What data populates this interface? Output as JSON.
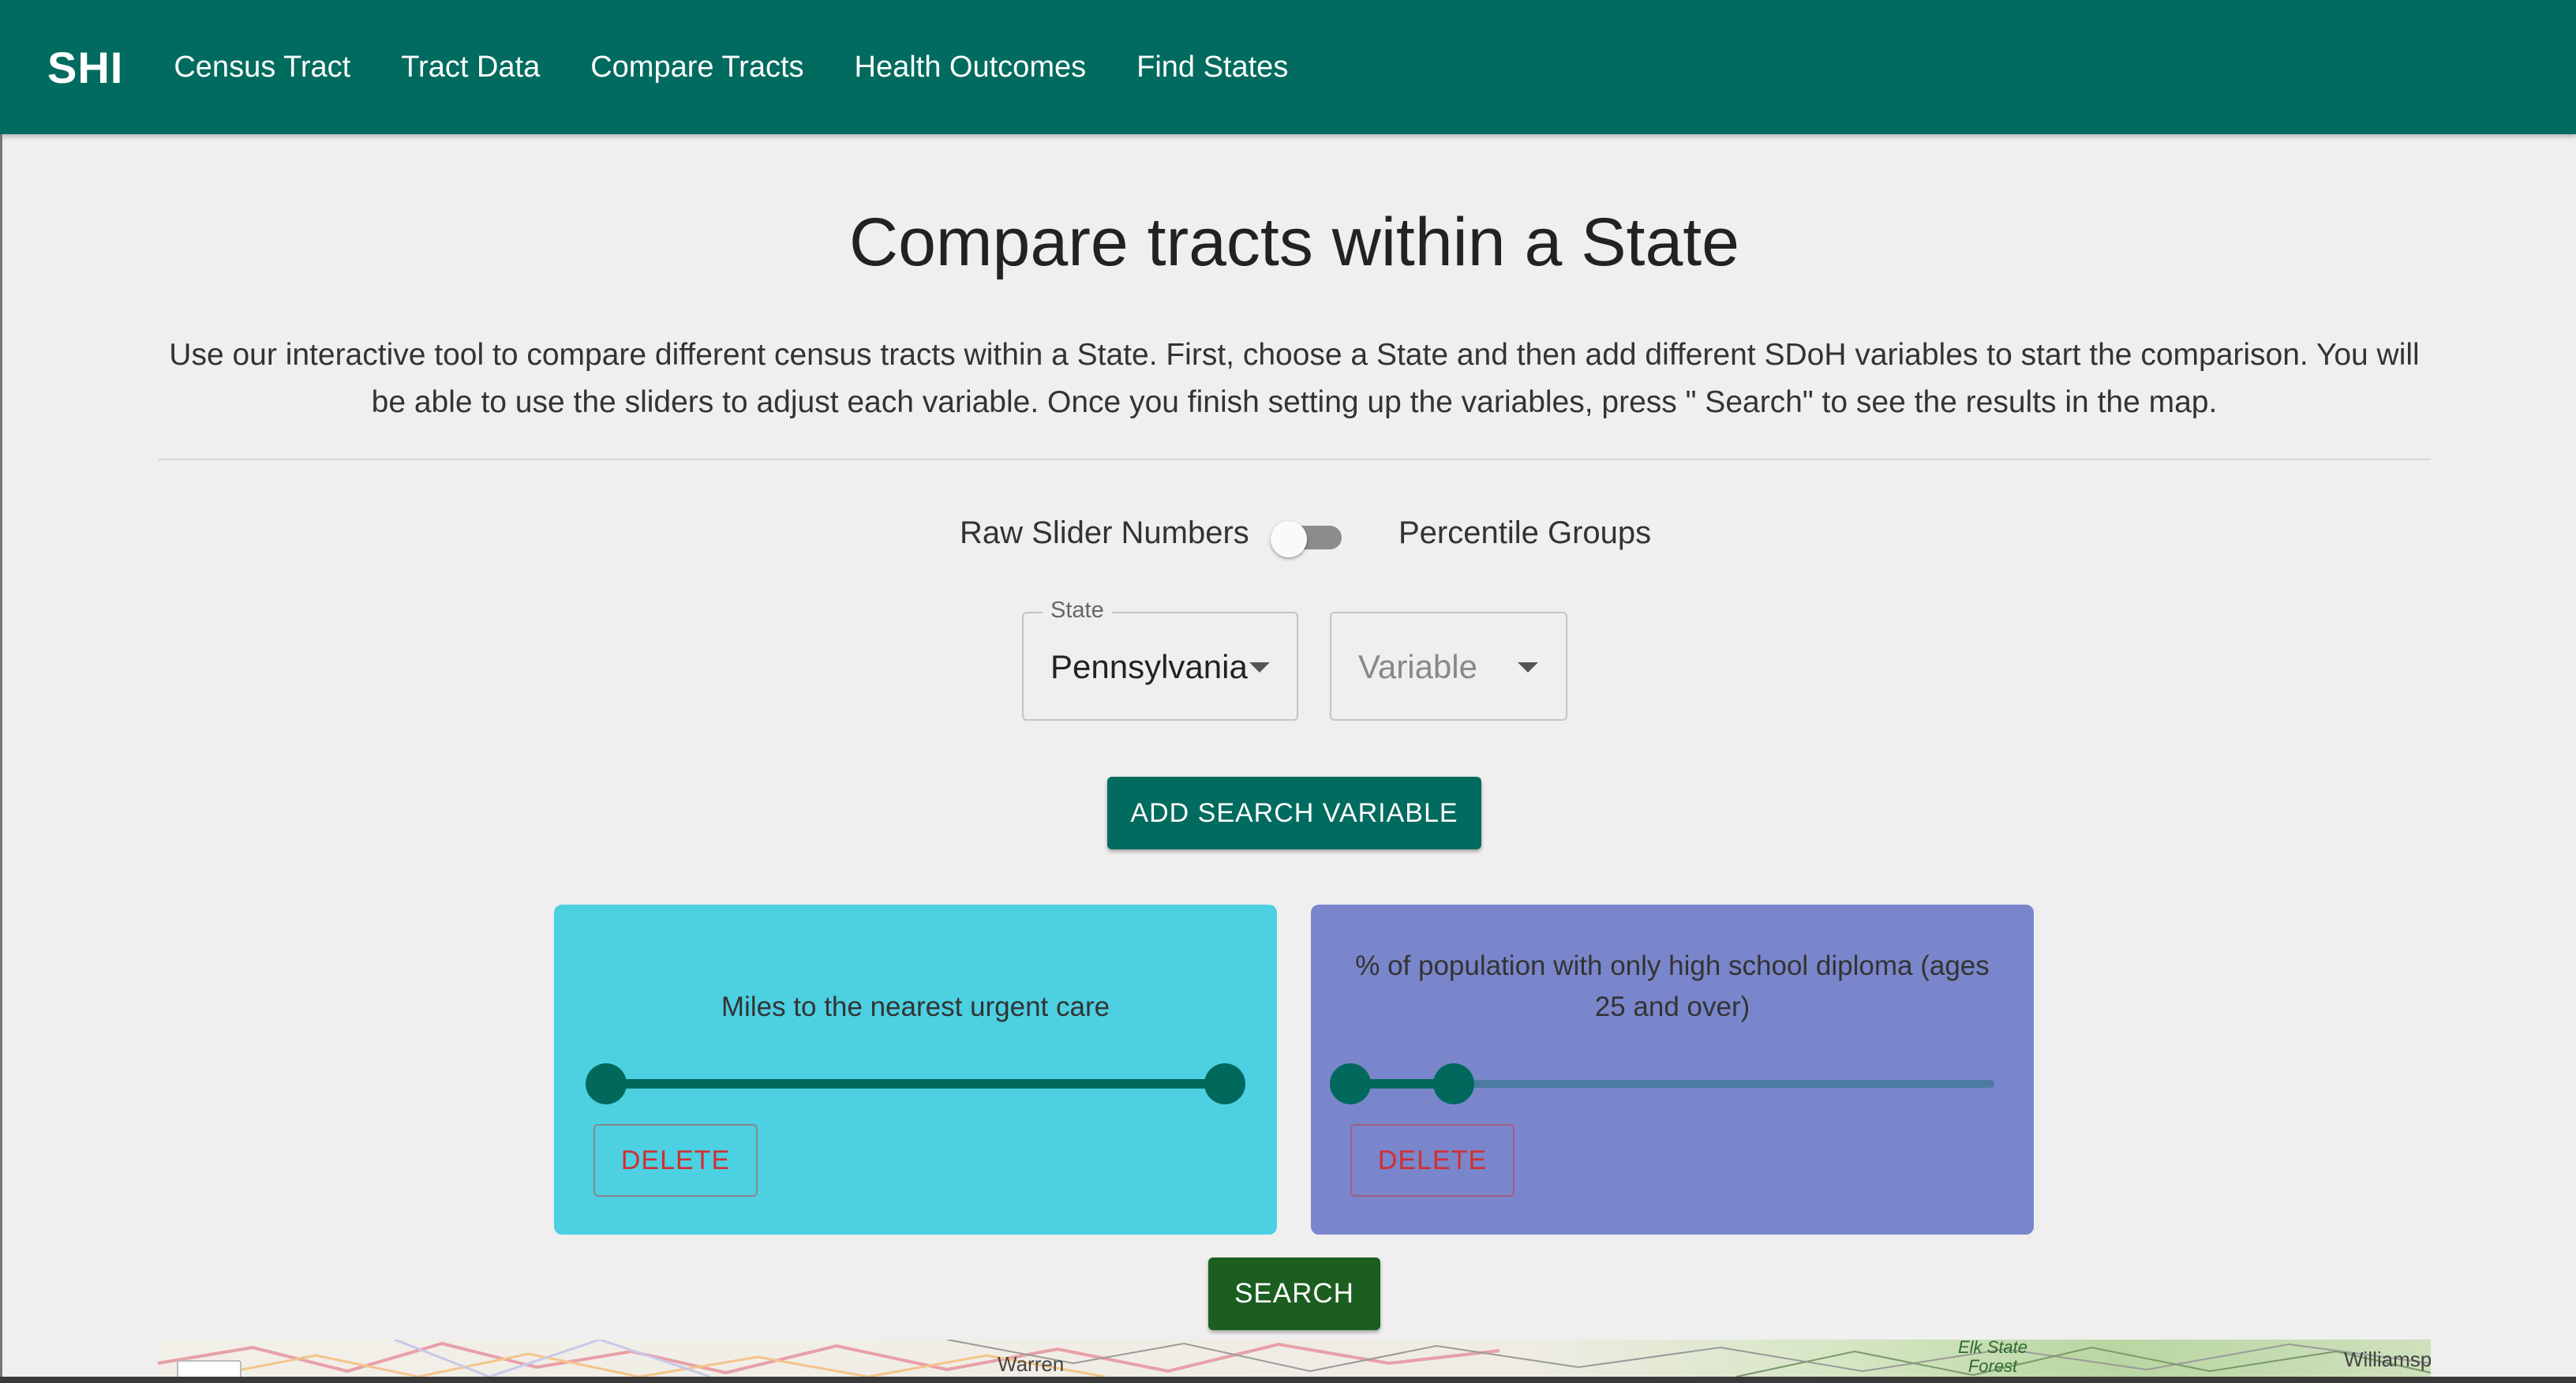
{
  "nav": {
    "brand": "SHI",
    "links": [
      "Census Tract",
      "Tract Data",
      "Compare Tracts",
      "Health Outcomes",
      "Find States"
    ]
  },
  "main": {
    "title": "Compare tracts within a State",
    "intro": "Use our interactive tool to compare different census tracts within a State. First, choose a State and then add different SDoH variables to start the comparison. You will be able to use the sliders to adjust each variable. Once you finish setting up the variables, press \" Search\" to see the results in the map.",
    "toggle": {
      "left_label": "Raw Slider Numbers",
      "right_label": "Percentile Groups",
      "checked": false
    },
    "state_select": {
      "legend": "State",
      "value": "Pennsylvania"
    },
    "variable_select": {
      "placeholder": "Variable"
    },
    "add_button": "ADD SEARCH VARIABLE",
    "cards": [
      {
        "title": "Miles to the nearest urgent care",
        "color": "#4dd0e1",
        "range": [
          0.02,
          0.98
        ],
        "delete_label": "DELETE"
      },
      {
        "title": "% of population with only high school diploma (ages 25 and over)",
        "color": "#7986cb",
        "range": [
          0.0,
          0.16
        ],
        "delete_label": "DELETE"
      }
    ],
    "search_button": "SEARCH"
  },
  "map": {
    "labels": [
      "Warren",
      "Elk State Forest",
      "Williamsp"
    ]
  },
  "colors": {
    "primary": "#006b5e",
    "search": "#1b5e20",
    "delete": "#d32f2f",
    "background": "#efefef"
  }
}
